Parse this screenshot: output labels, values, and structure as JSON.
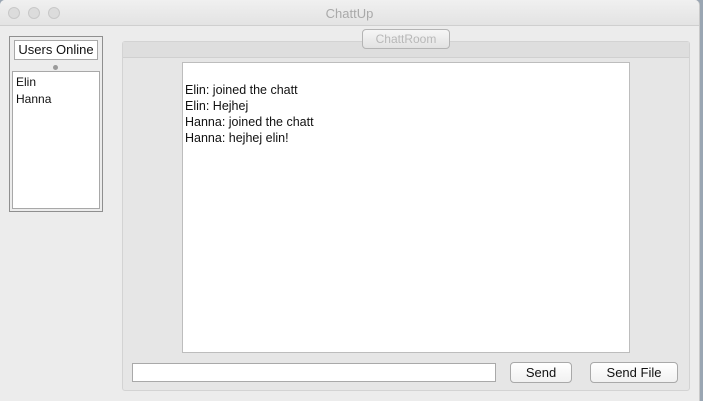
{
  "window": {
    "title": "ChattUp"
  },
  "users": {
    "header": "Users Online",
    "list": [
      "Elin",
      "Hanna"
    ]
  },
  "chat": {
    "tab_label": "ChattRoom",
    "messages": [
      "Elin: joined the chatt",
      "Elin: Hejhej",
      "Hanna: joined the chatt",
      "Hanna: hejhej elin!"
    ],
    "input_value": "",
    "send_label": "Send",
    "send_file_label": "Send File"
  }
}
